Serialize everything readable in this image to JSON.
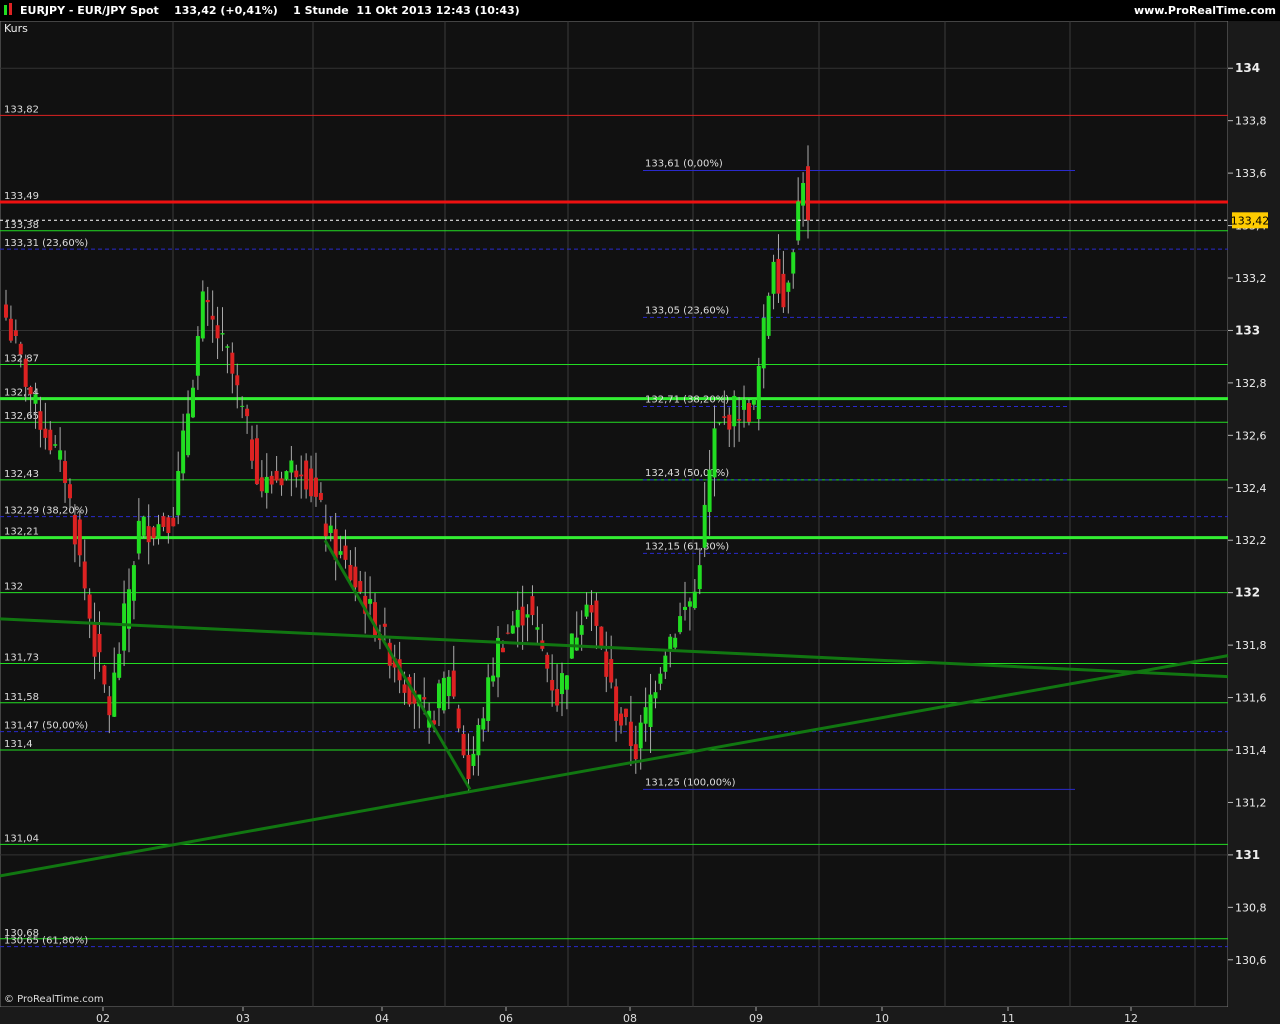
{
  "header": {
    "title": "EURJPY - EUR/JPY Spot    133,42 (+0,41%)    1 Stunde  11 Okt 2013 12:43 (10:43)",
    "site": "www.ProRealTime.com"
  },
  "panel": {
    "label": "Kurs",
    "watermark": "© ProRealTime.com"
  },
  "colors": {
    "background": "#111111",
    "up": "#22dd22",
    "down": "#dd2222",
    "support": "#22dd22",
    "resistance": "#dd2222",
    "fib": "#2a2acc",
    "trend": "#117711",
    "price_tag": "#ffcc00"
  },
  "chart_data": {
    "type": "candlestick",
    "ylim": [
      130.5,
      134.1
    ],
    "y_ticks": [
      {
        "v": 134,
        "label": "134",
        "major": true
      },
      {
        "v": 133.8,
        "label": "133,8"
      },
      {
        "v": 133.6,
        "label": "133,6"
      },
      {
        "v": 133.4,
        "label": "133,4"
      },
      {
        "v": 133.2,
        "label": "133,2"
      },
      {
        "v": 133,
        "label": "133",
        "major": true
      },
      {
        "v": 132.8,
        "label": "132,8"
      },
      {
        "v": 132.6,
        "label": "132,6"
      },
      {
        "v": 132.4,
        "label": "132,4"
      },
      {
        "v": 132.2,
        "label": "132,2"
      },
      {
        "v": 132,
        "label": "132",
        "major": true
      },
      {
        "v": 131.8,
        "label": "131,8"
      },
      {
        "v": 131.6,
        "label": "131,6"
      },
      {
        "v": 131.4,
        "label": "131,4"
      },
      {
        "v": 131.2,
        "label": "131,2"
      },
      {
        "v": 131,
        "label": "131",
        "major": true
      },
      {
        "v": 130.8,
        "label": "130,8"
      },
      {
        "v": 130.6,
        "label": "130,6"
      }
    ],
    "x_ticks": [
      "02",
      "03",
      "04",
      "06",
      "08",
      "09",
      "10",
      "11",
      "12"
    ],
    "last_price": {
      "value": 133.42,
      "label": "133,42"
    },
    "horizontal_levels": [
      {
        "value": 133.82,
        "label": "133,82",
        "color": "#dd2222",
        "width": 1
      },
      {
        "value": 133.49,
        "label": "133,49",
        "color": "#ee1111",
        "width": 3
      },
      {
        "value": 133.38,
        "label": "133,38",
        "color": "#22dd22",
        "width": 1
      },
      {
        "value": 132.87,
        "label": "132,87",
        "color": "#22dd22",
        "width": 1
      },
      {
        "value": 132.74,
        "label": "132,74",
        "color": "#33ee33",
        "width": 3
      },
      {
        "value": 132.65,
        "label": "132,65",
        "color": "#22dd22",
        "width": 1
      },
      {
        "value": 132.43,
        "label": "132,43",
        "color": "#22dd22",
        "width": 1
      },
      {
        "value": 132.21,
        "label": "132,21",
        "color": "#33ee33",
        "width": 3
      },
      {
        "value": 132.0,
        "label": "132",
        "color": "#22dd22",
        "width": 1
      },
      {
        "value": 131.73,
        "label": "131,73",
        "color": "#22dd22",
        "width": 1
      },
      {
        "value": 131.58,
        "label": "131,58",
        "color": "#22dd22",
        "width": 1
      },
      {
        "value": 131.4,
        "label": "131,4",
        "color": "#22dd22",
        "width": 1
      },
      {
        "value": 131.04,
        "label": "131,04",
        "color": "#22dd22",
        "width": 1
      },
      {
        "value": 130.68,
        "label": "130,68",
        "color": "#22dd22",
        "width": 1
      }
    ],
    "fib_left": [
      {
        "value": 133.31,
        "label": "133,31 (23,60%)"
      },
      {
        "value": 132.29,
        "label": "132,29 (38,20%)"
      },
      {
        "value": 131.47,
        "label": "131,47 (50,00%)"
      },
      {
        "value": 130.65,
        "label": "130,65 (61,80%)"
      }
    ],
    "fib_right": [
      {
        "value": 133.61,
        "label": "133,61 (0,00%)"
      },
      {
        "value": 133.05,
        "label": "133,05 (23,60%)"
      },
      {
        "value": 132.71,
        "label": "132,71 (38,20%)"
      },
      {
        "value": 132.43,
        "label": "132,43 (50,00%)"
      },
      {
        "value": 132.15,
        "label": "132,15 (61,80%)"
      },
      {
        "value": 131.25,
        "label": "131,25 (100,00%)"
      }
    ],
    "anchors": [
      {
        "bar": 0,
        "price": 133.05
      },
      {
        "bar": 6,
        "price": 132.7
      },
      {
        "bar": 12,
        "price": 132.45
      },
      {
        "bar": 18,
        "price": 131.8
      },
      {
        "bar": 21,
        "price": 131.55
      },
      {
        "bar": 27,
        "price": 132.25
      },
      {
        "bar": 30,
        "price": 132.25
      },
      {
        "bar": 34,
        "price": 132.3
      },
      {
        "bar": 40,
        "price": 133.1
      },
      {
        "bar": 45,
        "price": 132.9
      },
      {
        "bar": 52,
        "price": 132.4
      },
      {
        "bar": 60,
        "price": 132.5
      },
      {
        "bar": 66,
        "price": 132.2
      },
      {
        "bar": 72,
        "price": 132.0
      },
      {
        "bar": 80,
        "price": 131.7
      },
      {
        "bar": 86,
        "price": 131.5
      },
      {
        "bar": 90,
        "price": 131.7
      },
      {
        "bar": 94,
        "price": 131.3
      },
      {
        "bar": 100,
        "price": 131.8
      },
      {
        "bar": 106,
        "price": 131.95
      },
      {
        "bar": 112,
        "price": 131.6
      },
      {
        "bar": 118,
        "price": 132.0
      },
      {
        "bar": 124,
        "price": 131.55
      },
      {
        "bar": 128,
        "price": 131.4
      },
      {
        "bar": 134,
        "price": 131.8
      },
      {
        "bar": 140,
        "price": 132.0
      },
      {
        "bar": 144,
        "price": 132.6
      },
      {
        "bar": 148,
        "price": 132.7
      },
      {
        "bar": 152,
        "price": 132.7
      },
      {
        "bar": 156,
        "price": 133.3
      },
      {
        "bar": 158,
        "price": 133.1
      },
      {
        "bar": 162,
        "price": 133.6
      },
      {
        "bar": 163,
        "price": 133.42
      }
    ]
  }
}
